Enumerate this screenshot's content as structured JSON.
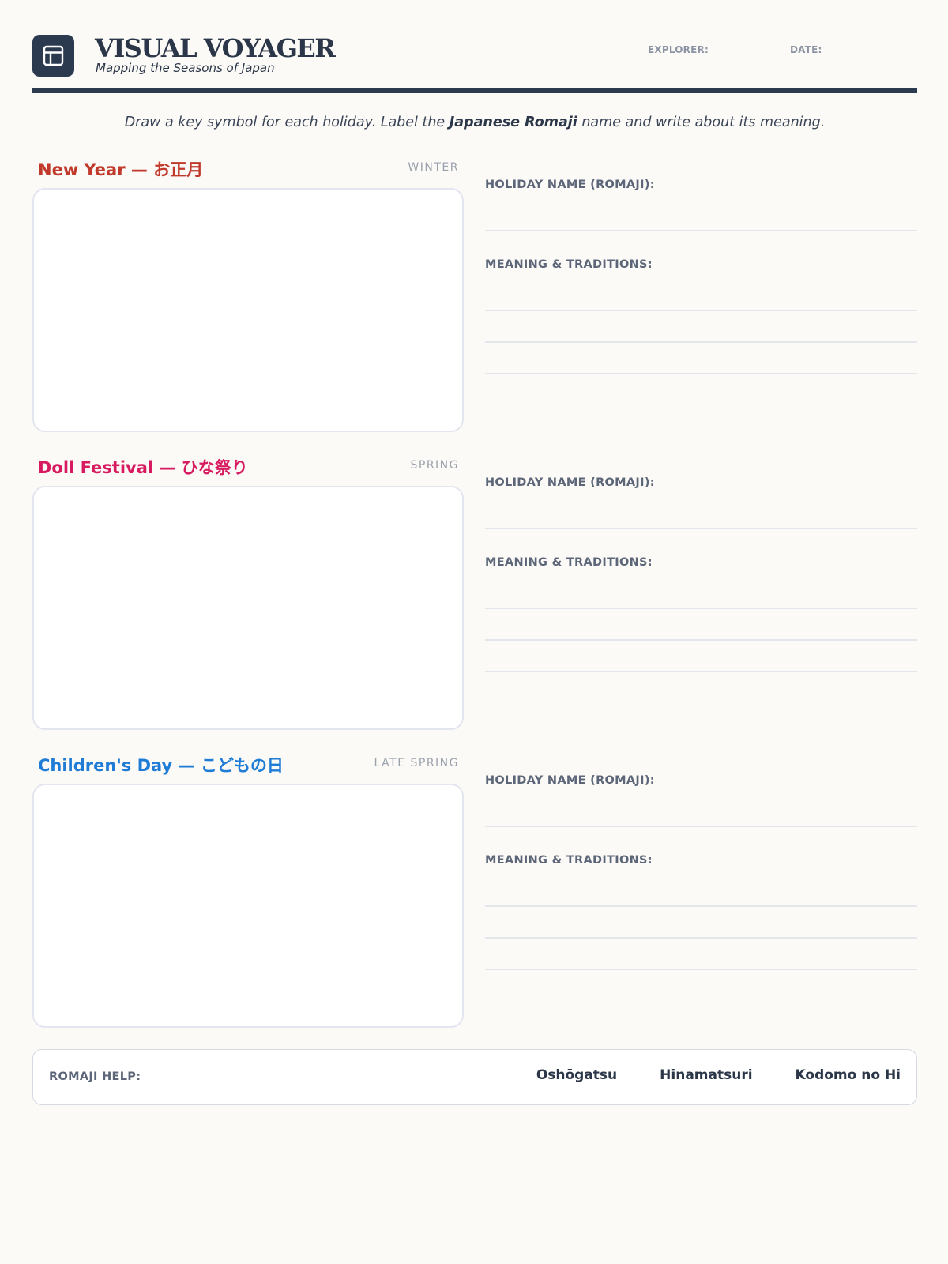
{
  "header": {
    "title": "VISUAL VOYAGER",
    "subtitle": "Mapping the Seasons of Japan",
    "explorer_label": "EXPLORER:",
    "date_label": "DATE:",
    "logo_icon": "layout-icon"
  },
  "instructions": {
    "part1": "Draw a key symbol for each holiday. Label the ",
    "bold": "Japanese Romaji",
    "part2": " name and write about its meaning."
  },
  "sections": [
    {
      "title": "New Year — お正月",
      "season": "WINTER",
      "color": "#c0392b",
      "name_label": "HOLIDAY NAME (ROMAJI):",
      "meaning_label": "MEANING & TRADITIONS:"
    },
    {
      "title": "Doll Festival — ひな祭り",
      "season": "SPRING",
      "color": "#d81b60",
      "name_label": "HOLIDAY NAME (ROMAJI):",
      "meaning_label": "MEANING & TRADITIONS:"
    },
    {
      "title": "Children's Day — こどもの日",
      "season": "LATE SPRING",
      "color": "#1e7bd6",
      "name_label": "HOLIDAY NAME (ROMAJI):",
      "meaning_label": "MEANING & TRADITIONS:"
    }
  ],
  "help": {
    "label": "ROMAJI HELP:",
    "terms": [
      "Oshōgatsu",
      "Hinamatsuri",
      "Kodomo no Hi"
    ]
  },
  "colors": {
    "navy": "#2c3a50",
    "background": "#fbfaf7"
  }
}
